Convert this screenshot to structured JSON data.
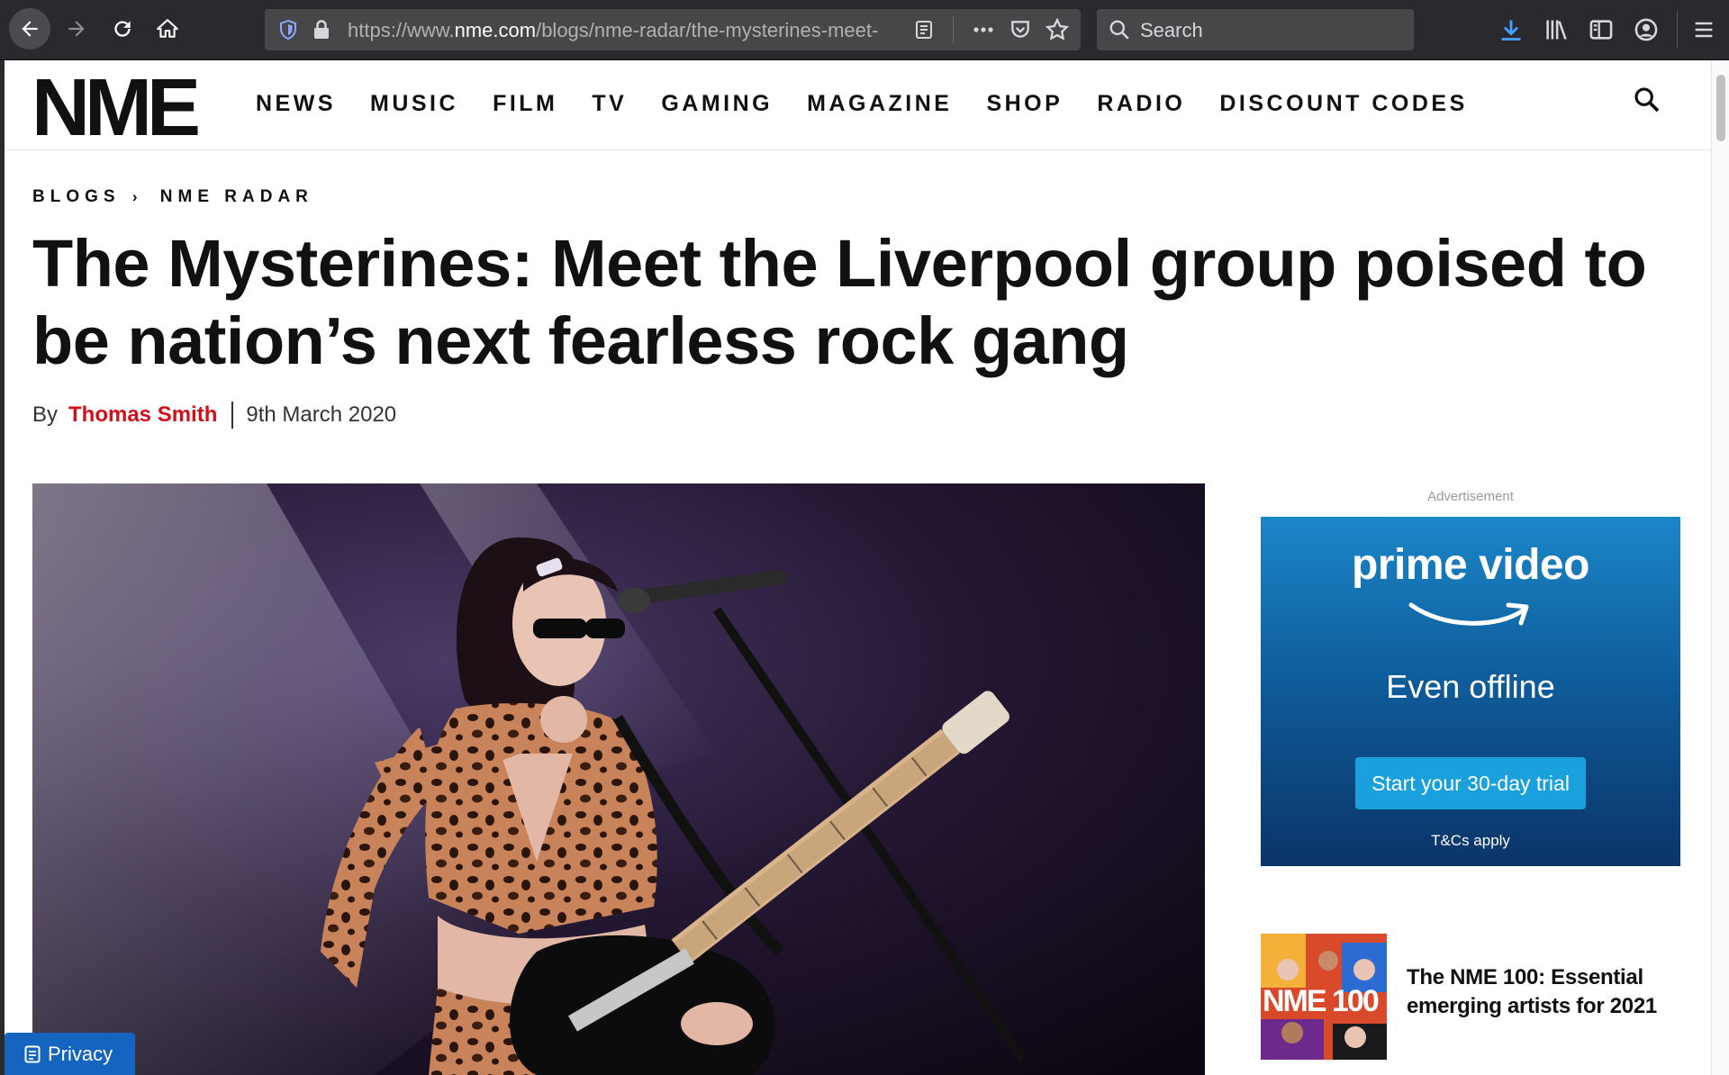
{
  "browser": {
    "url_prefix": "https://www.",
    "url_domain": "nme.com",
    "url_path": "/blogs/nme-radar/the-mysterines-meet-",
    "search_placeholder": "Search"
  },
  "site": {
    "logo": "NME",
    "nav": [
      "NEWS",
      "MUSIC",
      "FILM",
      "TV",
      "GAMING",
      "MAGAZINE",
      "SHOP",
      "RADIO",
      "DISCOUNT CODES"
    ]
  },
  "article": {
    "breadcrumb": [
      "BLOGS",
      "NME RADAR"
    ],
    "breadcrumb_separator": "›",
    "headline": "The Mysterines: Meet the Liverpool group poised to be nation’s next fearless rock gang",
    "byline_prefix": "By",
    "author": "Thomas Smith",
    "date": "9th March 2020"
  },
  "sidebar": {
    "ad_label": "Advertisement",
    "ad": {
      "brand": "prime video",
      "tagline": "Even offline",
      "cta": "Start your 30-day trial",
      "terms": "T&Cs apply"
    },
    "related": {
      "title": "The NME 100: Essential emerging artists for 2021",
      "thumb_text": "NME 100"
    }
  },
  "privacy_button": "Privacy",
  "colors": {
    "accent": "#d2101a",
    "toolbar": "#2a2a2e",
    "privacy": "#1565c0"
  }
}
